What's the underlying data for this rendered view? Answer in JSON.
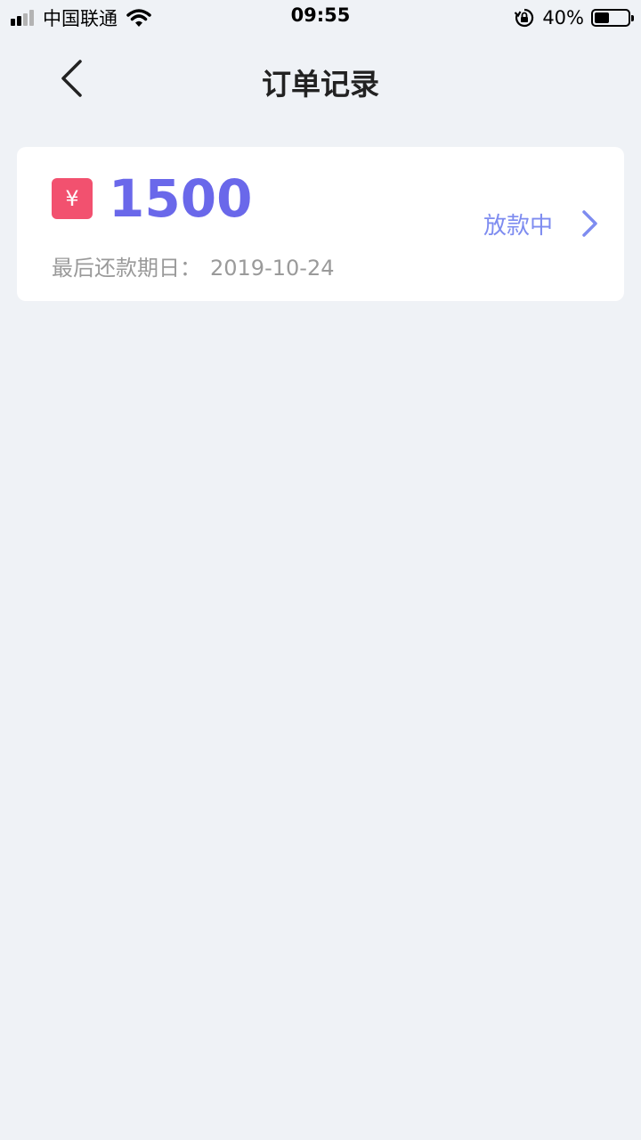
{
  "status_bar": {
    "carrier": "中国联通",
    "time": "09:55",
    "battery_percent": "40%",
    "icons": [
      "signal-icon",
      "wifi-icon",
      "orientation-lock-icon",
      "battery-icon"
    ]
  },
  "nav": {
    "title": "订单记录",
    "back_icon": "back-chevron-icon"
  },
  "order": {
    "currency_symbol": "¥",
    "amount": "1500",
    "due_label": "最后还款期日：",
    "due_date": "2019-10-24",
    "status": "放款中",
    "colors": {
      "amount": "#6a68ea",
      "badge": "#f2516f",
      "status": "#7e8cf0"
    }
  }
}
